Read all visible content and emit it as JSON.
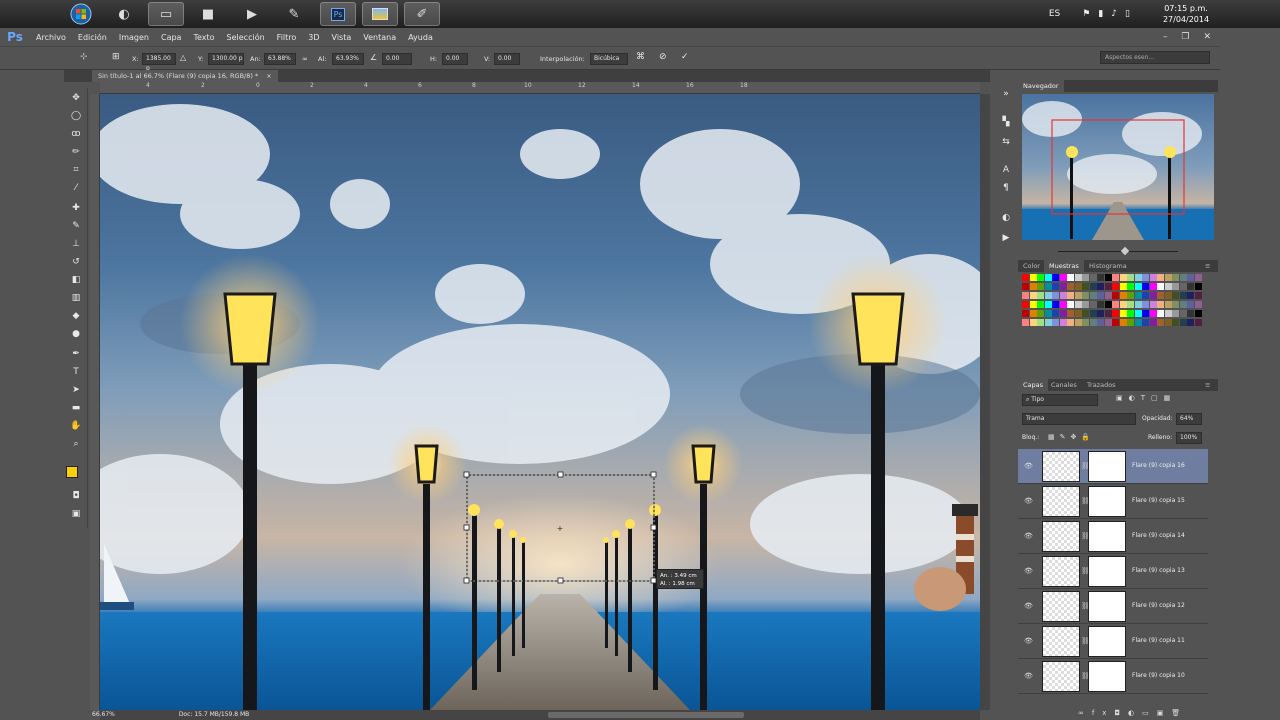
{
  "taskbar": {
    "language": "ES",
    "time": "07:15 p.m.",
    "date": "27/04/2014"
  },
  "menu": {
    "logo": "Ps",
    "items": [
      "Archivo",
      "Edición",
      "Imagen",
      "Capa",
      "Texto",
      "Selección",
      "Filtro",
      "3D",
      "Vista",
      "Ventana",
      "Ayuda"
    ]
  },
  "options": {
    "x_label": "X:",
    "x_value": "1385.00 p",
    "y_label": "Y:",
    "y_value": "1300.00 p",
    "w_label": "An:",
    "w_value": "63.88%",
    "h_label": "Al:",
    "h_value": "63.93%",
    "angle_value": "0.00",
    "hskew_label": "H:",
    "hskew_value": "0.00",
    "vskew_label": "V:",
    "vskew_value": "0.00",
    "interp_label": "Interpolación:",
    "interp_value": "Bicúbica",
    "workspace": "Aspectos esen..."
  },
  "document": {
    "tab_title": "Sin título-1 al 66.7% (Flare (9) copia 16, RGB/8) *",
    "zoom": "66.67%",
    "doc_info": "Doc: 15.7 MB/159.8 MB",
    "transform_readout": [
      "An. :  3.49 cm",
      "Al. :  1.98 cm"
    ]
  },
  "ruler": {
    "top": [
      "4",
      "2",
      "0",
      "2",
      "4",
      "6",
      "8",
      "10",
      "12",
      "14",
      "16",
      "18"
    ]
  },
  "panels": {
    "navigator_title": "Navegador",
    "color_tabs": [
      "Color",
      "Muestras",
      "Histograma"
    ],
    "layers_tabs": [
      "Capas",
      "Canales",
      "Trazados"
    ],
    "filter_kind": "Tipo",
    "blend_mode": "Trama",
    "opacity_label": "Opacidad:",
    "opacity_value": "64%",
    "lock_label": "Bloq.:",
    "fill_label": "Relleno:",
    "fill_value": "100%",
    "layers": [
      {
        "name": "Flare (9) copia 16",
        "selected": true
      },
      {
        "name": "Flare (9) copia 15",
        "selected": false
      },
      {
        "name": "Flare (9) copia 14",
        "selected": false
      },
      {
        "name": "Flare (9) copia 13",
        "selected": false
      },
      {
        "name": "Flare (9) copia 12",
        "selected": false
      },
      {
        "name": "Flare (9) copia 11",
        "selected": false
      },
      {
        "name": "Flare (9) copia 10",
        "selected": false
      }
    ]
  },
  "colors": {
    "accent_blue": "#6aa8ff",
    "foreground": "#f4d000",
    "background": "#ffffff",
    "selected_layer": "#6f7ea0"
  }
}
